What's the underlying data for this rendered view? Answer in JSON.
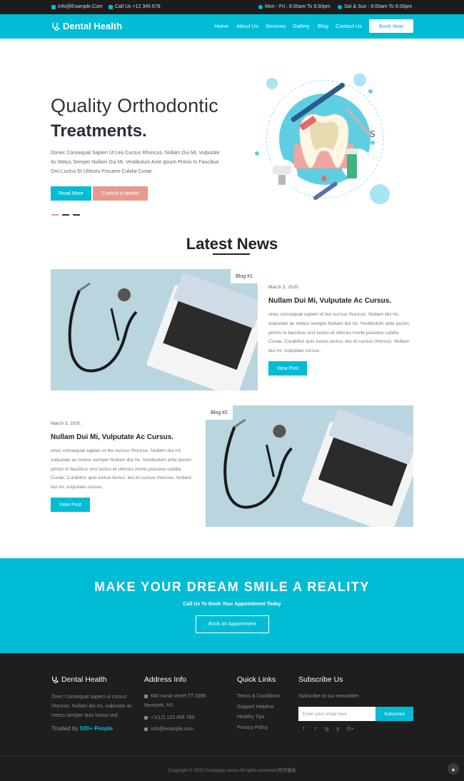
{
  "topbar": {
    "email": "Info@Example.Com",
    "phone": "Call Us +12 345 678",
    "hours_weekday": "Mon - Fri : 8:30am To 9:30pm",
    "hours_weekend": "Sat & Sun : 9:00am To 6:00pm"
  },
  "nav": {
    "brand": "Dental Health",
    "items": [
      "Home",
      "About Us",
      "Services",
      "Gallery",
      "Blog",
      "Contact Us"
    ],
    "cta": "Book Now"
  },
  "hero": {
    "title_line1": "Quality Orthodontic",
    "title_line2": "Treatments.",
    "text": "Donec Consequat Sapien Ut Leo Cursus Rhoncus. Nullam Dui Mi, Vulputate Ac Metus Semper Nullam Dui Mi. Vestibulum Ante Ipsum Primis In Faucibus Orci Luctus Et Ultrices Posuere Cubilia Curae.",
    "btn_primary": "Read More",
    "btn_secondary": "Consult a dentist",
    "slides": 3,
    "active_slide": 1
  },
  "news": {
    "title": "Latest News",
    "posts": [
      {
        "tag": "Blog #1",
        "date": "March 3, 2020.",
        "title": "Nullam Dui Mi, Vulputate Ac Cursus.",
        "text": "onec consequat sapien ut leo cursus rhoncus. Nullam dui mi, vulputate ac metus semper Nullam dui mi. Vestibulum ante ipsum primis in faucibus orci luctus et ultrices morbi posuere cubilia Curae; Curabitur quis luctus lectus, leo et cursus rhoncus. Nullam dui mi, vulputate cursus.",
        "button": "View Post"
      },
      {
        "tag": "Blog #2",
        "date": "March 3, 2020.",
        "title": "Nullam Dui Mi, Vulputate Ac Cursus.",
        "text": "onec consequat sapien ut leo cursus rhoncus. Nullam dui mi, vulputate ac metus semper Nullam dui mi. Vestibulum ante ipsum primis in faucibus orci luctus et ultrices morbi posuere cubilia Curae; Curabitur quis luctus lectus, leo et cursus rhoncus. Nullam dui mi, vulputate cursus.",
        "button": "View Post"
      }
    ]
  },
  "cta": {
    "title": "MAKE YOUR DREAM SMILE A REALITY",
    "subtitle": "Call Us To Book Your Appointment Today",
    "button": "Book an Appointment"
  },
  "footer": {
    "about": {
      "brand": "Dental Health",
      "text": "Onec Consequat sapien ut cursus rhoncus. Nullam dui mi, vulputate ac metus semper quis luctus sed.",
      "trusted_prefix": "Trusted by",
      "trusted_count": "500+ People"
    },
    "address": {
      "heading": "Address Info",
      "street": "640 canal street TT 3356",
      "city": "Newyork, NY.",
      "phone": "+1(12) 123 456 789",
      "email": "info@example.com"
    },
    "links": {
      "heading": "Quick Links",
      "items": [
        "Terms & Conditions",
        "Support Helpline",
        "Healthy Tips",
        "Privacy Policy"
      ]
    },
    "subscribe": {
      "heading": "Subscribe Us",
      "text": "Subscribe to our newsletter",
      "placeholder": "Enter your email here",
      "button": "Subscribe",
      "socials": [
        "f",
        "t",
        "ig",
        "p",
        "G+"
      ]
    },
    "copyright": "Copyright © 2020 Company name All rights reserved.网页模板"
  },
  "colors": {
    "accent": "#00bcd4",
    "accent_pink": "#e89a8e",
    "dark": "#1e1e1e"
  }
}
